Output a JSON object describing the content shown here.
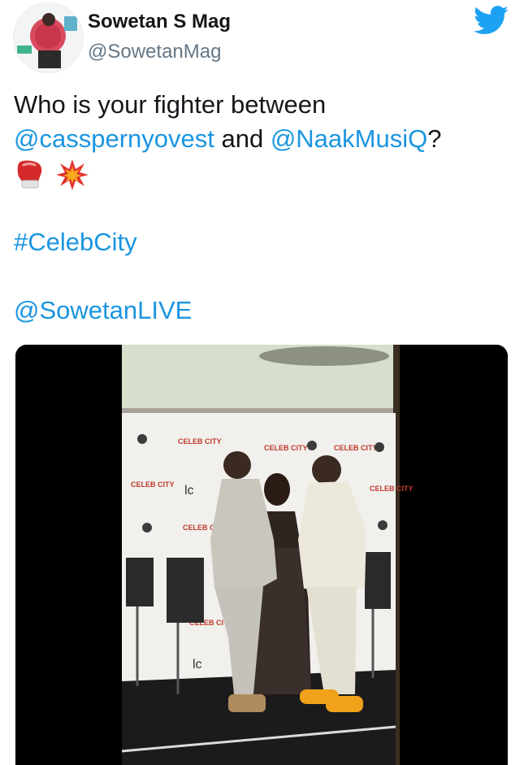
{
  "tweet": {
    "author": {
      "name": "Sowetan S Mag",
      "handle": "@SowetanMag"
    },
    "text": {
      "line1": "Who is your fighter between",
      "mention1": "@casspernyovest",
      "and": " and ",
      "mention2": "@NaakMusiQ",
      "question": "?",
      "hashtag": "#CelebCity",
      "mention3": "@SowetanLIVE"
    },
    "icons": {
      "brand": "twitter-bird-icon",
      "emoji1": "boxing-glove-icon",
      "emoji2": "collision-icon"
    },
    "media": {
      "backdrop_text": [
        "CELEB CITY",
        "CELEB CITY",
        "CELEB CITY",
        "CELEB CITY",
        "CELEB CITY",
        "CELEB CITY",
        "CELEB CITY"
      ],
      "backdrop_logo": [
        "lc",
        "lc"
      ]
    },
    "colors": {
      "link": "#1b95e0",
      "brand": "#1da1f2",
      "name": "#14171a",
      "secondary": "#657786"
    }
  }
}
